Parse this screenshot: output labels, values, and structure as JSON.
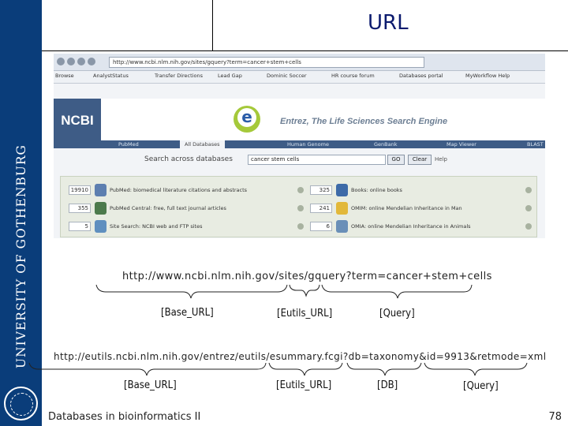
{
  "sidebar": {
    "university": "UNIVERSITY OF GOTHENBURG"
  },
  "slide": {
    "title": "URL",
    "footer": "Databases in bioinformatics II",
    "page_number": "78"
  },
  "browser": {
    "bookmarks": [
      "Browse",
      "AnalystStatus",
      "Transfer Directions",
      "Lead Gap",
      "Dominic Soccer",
      "HR course forum",
      "Databases portal",
      "MyWorkflow Help"
    ],
    "ncbi_logo": "NCBI",
    "entrez_tagline": "Entrez, The Life Sciences Search Engine",
    "tabs": [
      "PubMed",
      "All Databases",
      "Human Genome",
      "GenBank",
      "Map Viewer",
      "BLAST"
    ],
    "search_label": "Search across databases",
    "search_value": "cancer stem cells",
    "go_button": "GO",
    "clear_button": "Clear",
    "help_link": "Help",
    "results": [
      {
        "count": "19910",
        "text": "PubMed: biomedical literature citations and abstracts"
      },
      {
        "count": "355",
        "text": "PubMed Central: free, full text journal articles"
      },
      {
        "count": "5",
        "text": "Site Search: NCBI web and FTP sites"
      },
      {
        "count": "325",
        "text": "Books: online books"
      },
      {
        "count": "241",
        "text": "OMIM: online Mendelian Inheritance in Man"
      },
      {
        "count": "6",
        "text": "OMIA: online Mendelian Inheritance in Animals"
      }
    ]
  },
  "example1": {
    "url": "http://www.ncbi.nlm.nih.gov/sites/gquery?term=cancer+stem+cells",
    "labels": [
      "[Base_URL]",
      "[Eutils_URL]",
      "[Query]"
    ]
  },
  "example2": {
    "url": "http://eutils.ncbi.nlm.nih.gov/entrez/eutils/esummary.fcgi?db=taxonomy&id=9913&retmode=xml",
    "labels": [
      "[Base_URL]",
      "[Eutils_URL]",
      "[DB]",
      "[Query]"
    ]
  },
  "colors": {
    "uni_blue": "#0a3d7a",
    "title": "#0b1a6e",
    "ncbi_blue": "#3e5c86",
    "entrez_green": "#a5c93a"
  }
}
